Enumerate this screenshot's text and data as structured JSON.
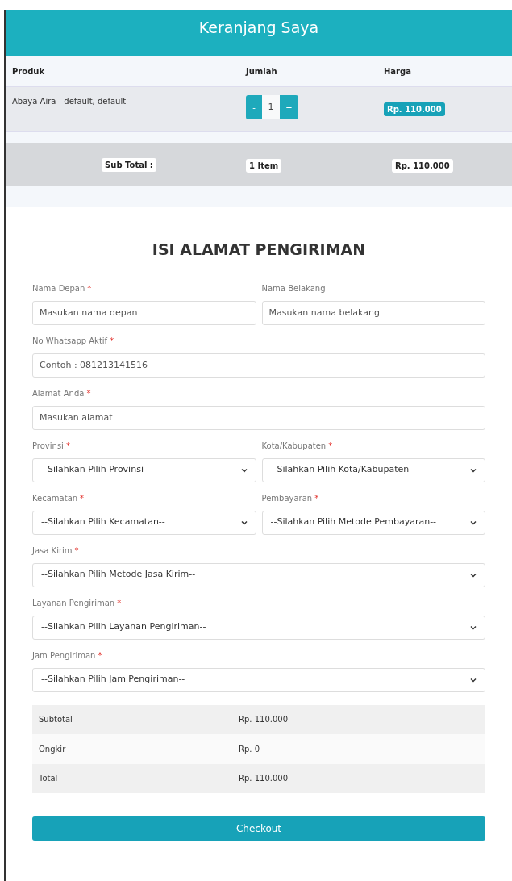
{
  "header": {
    "title": "Keranjang Saya"
  },
  "cart": {
    "columns": [
      "Produk",
      "Jumlah",
      "Harga"
    ],
    "rows": [
      {
        "product": "Abaya Aira - default, default",
        "minus": "-",
        "quantity": "1",
        "plus": "+",
        "price": "Rp. 110.000"
      }
    ],
    "subtotal": {
      "label": "Sub Total :",
      "items": "1 Item",
      "amount": "Rp. 110.000"
    }
  },
  "form": {
    "title": "ISI ALAMAT PENGIRIMAN",
    "rows": [
      [
        {
          "label": "Nama Depan",
          "mark": "*",
          "kind": "input",
          "placeholder": "Masukan nama depan"
        },
        {
          "label": "Nama Belakang",
          "kind": "input",
          "placeholder": "Masukan nama belakang"
        }
      ],
      [
        {
          "label": "No Whatsapp Aktif",
          "mark": "*",
          "kind": "input",
          "placeholder": "Contoh : 081213141516"
        }
      ],
      [
        {
          "label": "Alamat Anda",
          "mark": "*",
          "kind": "input",
          "placeholder": "Masukan alamat"
        }
      ],
      [
        {
          "label": "Provinsi",
          "mark": "*",
          "kind": "select",
          "value": "--Silahkan Pilih Provinsi--"
        },
        {
          "label": "Kota/Kabupaten",
          "mark": "*",
          "kind": "select",
          "value": "--Silahkan Pilih Kota/Kabupaten--"
        }
      ],
      [
        {
          "label": "Kecamatan",
          "mark": "*",
          "kind": "select",
          "value": "--Silahkan Pilih Kecamatan--"
        },
        {
          "label": "Pembayaran",
          "mark": "*",
          "kind": "select",
          "value": "--Silahkan Pilih Metode Pembayaran--"
        }
      ],
      [
        {
          "label": "Jasa Kirim",
          "mark": "*",
          "kind": "select",
          "value": "--Silahkan Pilih Metode Jasa Kirim--"
        }
      ],
      [
        {
          "label": "Layanan Pengiriman",
          "mark": "*",
          "kind": "select",
          "value": "--Silahkan Pilih Layanan Pengiriman--"
        }
      ],
      [
        {
          "label": "Jam Pengiriman",
          "mark": "*",
          "kind": "select",
          "value": "--Silahkan Pilih Jam Pengiriman--"
        }
      ]
    ],
    "summary": [
      {
        "label": "Subtotal",
        "value": "Rp. 110.000"
      },
      {
        "label": "Ongkir",
        "value": "Rp. 0"
      },
      {
        "label": "Total",
        "value": "Rp. 110.000"
      }
    ],
    "checkout": "Checkout"
  }
}
